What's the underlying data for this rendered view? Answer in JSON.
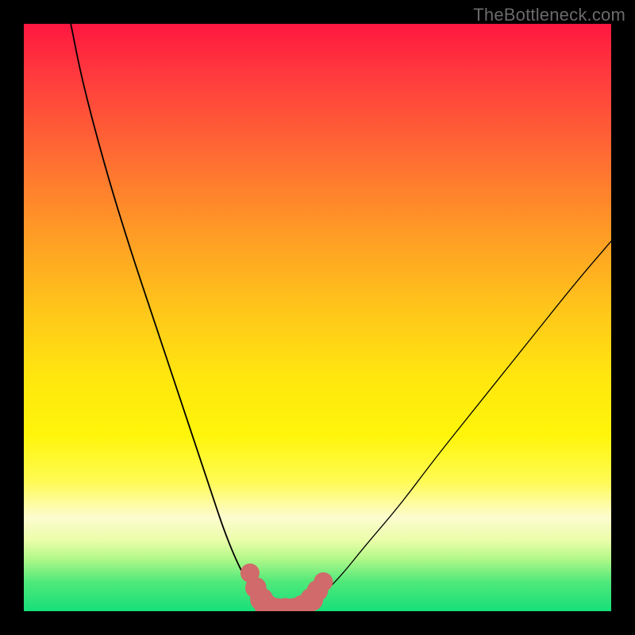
{
  "watermark": "TheBottleneck.com",
  "chart_data": {
    "type": "line",
    "title": "",
    "xlabel": "",
    "ylabel": "",
    "ylim": [
      0,
      100
    ],
    "xlim": [
      0,
      100
    ],
    "series": [
      {
        "name": "left-curve",
        "x": [
          8,
          10,
          14,
          18,
          22,
          26,
          30,
          32,
          34,
          36,
          38,
          40,
          41
        ],
        "y": [
          100,
          90,
          75,
          62,
          50,
          38,
          26,
          20,
          14,
          9,
          5,
          2,
          0
        ]
      },
      {
        "name": "right-curve",
        "x": [
          48,
          50,
          54,
          58,
          64,
          70,
          78,
          86,
          94,
          100
        ],
        "y": [
          0,
          2,
          6,
          11,
          18,
          26,
          36,
          46,
          56,
          63
        ]
      },
      {
        "name": "valley-floor",
        "x": [
          41,
          42,
          44,
          46,
          48
        ],
        "y": [
          0,
          0,
          0,
          0,
          0
        ]
      }
    ],
    "markers": {
      "name": "valley-dots",
      "color": "#d16a6a",
      "points": [
        {
          "x": 38.5,
          "y": 6.5,
          "r": 1.2
        },
        {
          "x": 39.5,
          "y": 4.0,
          "r": 1.4
        },
        {
          "x": 40.5,
          "y": 2.0,
          "r": 1.6
        },
        {
          "x": 41.5,
          "y": 0.6,
          "r": 1.8
        },
        {
          "x": 43.0,
          "y": 0.0,
          "r": 1.9
        },
        {
          "x": 44.5,
          "y": 0.0,
          "r": 1.9
        },
        {
          "x": 46.0,
          "y": 0.0,
          "r": 1.9
        },
        {
          "x": 47.5,
          "y": 0.6,
          "r": 1.8
        },
        {
          "x": 49.0,
          "y": 2.0,
          "r": 1.6
        },
        {
          "x": 50.0,
          "y": 3.5,
          "r": 1.4
        },
        {
          "x": 51.0,
          "y": 5.0,
          "r": 1.2
        }
      ]
    }
  }
}
